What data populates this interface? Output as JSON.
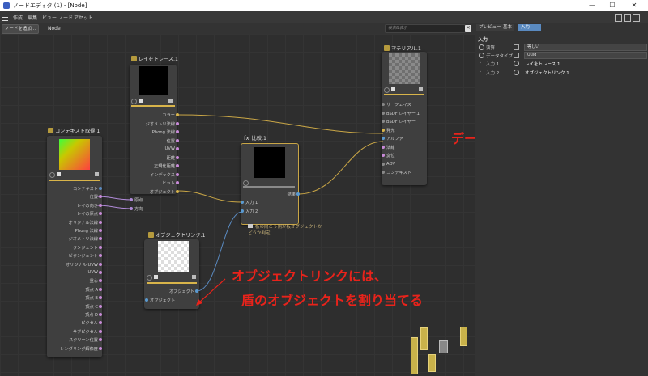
{
  "window": {
    "title": "ノードエディタ (1) - [Node]",
    "minimize": "—",
    "maximize": "☐",
    "close": "✕"
  },
  "menu": [
    "作成",
    "編集",
    "ビュー",
    "ノード",
    "アセット"
  ],
  "toolbar": {
    "add_node": "ノードを追加...",
    "breadcrumb": "Node",
    "search_placeholder": "検索&表示",
    "clear": "✕"
  },
  "nodes": {
    "raytrace": {
      "title": "レイをトレース.1",
      "inputs": [
        "原点",
        "方向"
      ],
      "outputs": [
        "カラー",
        "ジオメトリ法線",
        "Phong 法線",
        "位置",
        "UVW",
        "距離",
        "正規化距離",
        "インデックス",
        "ヒット",
        "オブジェクト"
      ]
    },
    "context": {
      "title": "コンテキスト取得.1",
      "outputs": [
        "コンテキスト",
        "位置",
        "レイの向き",
        "レイの原点",
        "オリジナル法線",
        "Phong 法線",
        "ジオメトリ法線",
        "タンジェント",
        "ビタンジェント",
        "オリジナル UVW",
        "UVW",
        "重心",
        "頂点 A",
        "頂点 B",
        "頂点 C",
        "頂点 D",
        "ピクセル",
        "サブピクセル",
        "スクリーン位置",
        "レンダリング解像度"
      ]
    },
    "compare": {
      "title": "比較.1",
      "prefix": "fx",
      "inputs": [
        "入力 1",
        "入力 2"
      ],
      "output": "結果",
      "note": "板の向こう側が板オブジェクトかどうか判定"
    },
    "material": {
      "title": "マテリアル.1",
      "rows": [
        "サーフェイス",
        "BSDF レイヤー.1",
        "BSDF レイヤー",
        "発光",
        "アルファ",
        "法線",
        "変位",
        "AOV",
        "コンテキスト"
      ]
    },
    "objlink": {
      "title": "オブジェクトリンク.1",
      "output": "オブジェクト",
      "input": "オブジェクト"
    }
  },
  "annotations": {
    "datatype": "データタイプは、Uuidに",
    "objlink_line1": "オブジェクトリンクには、",
    "objlink_line2": "盾のオブジェクトを割り当てる"
  },
  "panel": {
    "tabs": [
      "プレビュー",
      "基本",
      "入力"
    ],
    "active_tab": "入力",
    "section": "入力",
    "rows": [
      {
        "label": "演算",
        "value": "等しい"
      },
      {
        "label": "データタイプ",
        "value": "Uuid"
      },
      {
        "label": "入力 1..",
        "value": "レイをトレース.1"
      },
      {
        "label": "入力 2..",
        "value": "オブジェクトリンク.1"
      }
    ]
  },
  "colors": {
    "accent": "#d8b44a",
    "annotation": "#e8231b",
    "wire": "#c9a646",
    "active_tab": "#5a8ac0"
  }
}
